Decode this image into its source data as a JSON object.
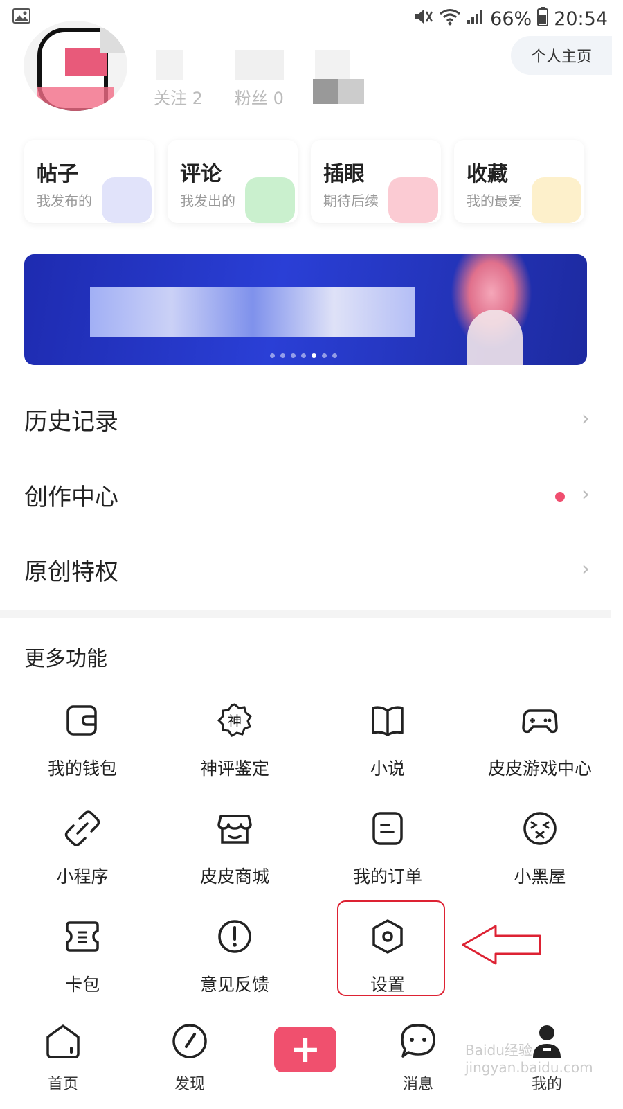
{
  "status_bar": {
    "battery": "66%",
    "time": "20:54"
  },
  "profile": {
    "button_label": "个人主页",
    "stats": [
      {
        "label": "关注",
        "value": "2"
      },
      {
        "label": "粉丝",
        "value": "0"
      }
    ]
  },
  "quick_cards": [
    {
      "title": "帖子",
      "subtitle": "我发布的"
    },
    {
      "title": "评论",
      "subtitle": "我发出的"
    },
    {
      "title": "插眼",
      "subtitle": "期待后续"
    },
    {
      "title": "收藏",
      "subtitle": "我的最爱"
    }
  ],
  "banner": {
    "dots": 7,
    "active_index": 4
  },
  "menu_rows": [
    {
      "label": "历史记录"
    },
    {
      "label": "创作中心"
    },
    {
      "label": "原创特权"
    }
  ],
  "more": {
    "title": "更多功能",
    "items": [
      {
        "label": "我的钱包",
        "icon": "wallet-icon"
      },
      {
        "label": "神评鉴定",
        "icon": "badge-icon"
      },
      {
        "label": "小说",
        "icon": "book-icon"
      },
      {
        "label": "皮皮游戏中心",
        "icon": "gamepad-icon"
      },
      {
        "label": "小程序",
        "icon": "link-icon"
      },
      {
        "label": "皮皮商城",
        "icon": "store-icon"
      },
      {
        "label": "我的订单",
        "icon": "order-icon"
      },
      {
        "label": "小黑屋",
        "icon": "dizzy-face-icon"
      },
      {
        "label": "卡包",
        "icon": "ticket-icon"
      },
      {
        "label": "意见反馈",
        "icon": "exclamation-icon"
      },
      {
        "label": "设置",
        "icon": "settings-hexagon-icon"
      }
    ],
    "badge_glyph": "神"
  },
  "tabbar": {
    "tabs": [
      {
        "label": "首页",
        "icon": "home-icon"
      },
      {
        "label": "发现",
        "icon": "compass-icon"
      },
      {
        "label": "消息",
        "icon": "chat-icon"
      },
      {
        "label": "我的",
        "icon": "profile-icon"
      }
    ],
    "plus": "+"
  },
  "watermark": "Baidu经验 jingyan.baidu.com",
  "colors": {
    "accent": "#f0506e",
    "highlight": "#dd2233",
    "banner": "#2a3fd6"
  }
}
